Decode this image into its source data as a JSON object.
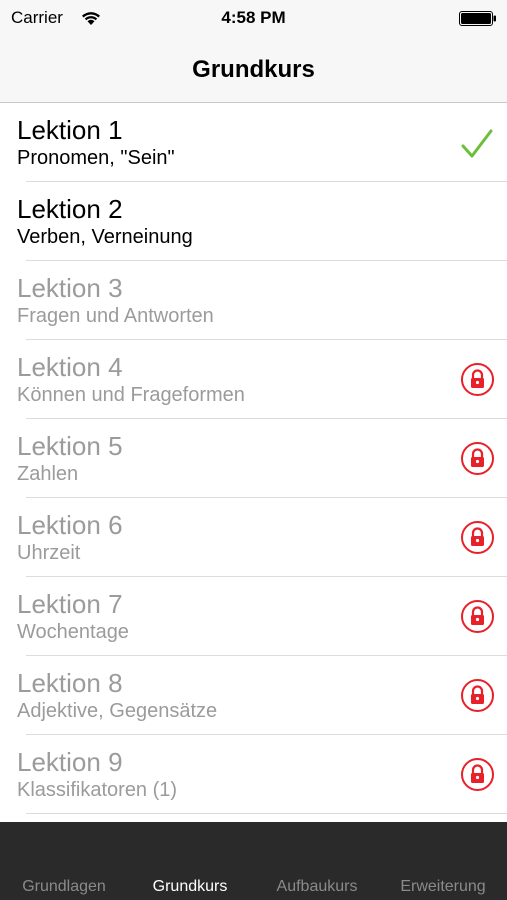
{
  "status_bar": {
    "carrier": "Carrier",
    "time": "4:58 PM",
    "wifi_icon": "wifi-icon",
    "battery_icon": "battery-icon"
  },
  "nav": {
    "title": "Grundkurs"
  },
  "colors": {
    "check": "#6cbf3a",
    "lock": "#e8202a",
    "locked_text": "#9b9b9b",
    "tab_bar": "#2a2a2a"
  },
  "lessons": [
    {
      "title": "Lektion 1",
      "subtitle": "Pronomen, \"Sein\"",
      "state": "completed",
      "icon": "checkmark-icon"
    },
    {
      "title": "Lektion 2",
      "subtitle": "Verben, Verneinung",
      "state": "available",
      "icon": ""
    },
    {
      "title": "Lektion 3",
      "subtitle": "Fragen und Antworten",
      "state": "disabled",
      "icon": ""
    },
    {
      "title": "Lektion 4",
      "subtitle": "Können und Frageformen",
      "state": "locked",
      "icon": "lock-icon"
    },
    {
      "title": "Lektion 5",
      "subtitle": "Zahlen",
      "state": "locked",
      "icon": "lock-icon"
    },
    {
      "title": "Lektion 6",
      "subtitle": "Uhrzeit",
      "state": "locked",
      "icon": "lock-icon"
    },
    {
      "title": "Lektion 7",
      "subtitle": "Wochentage",
      "state": "locked",
      "icon": "lock-icon"
    },
    {
      "title": "Lektion 8",
      "subtitle": "Adjektive, Gegensätze",
      "state": "locked",
      "icon": "lock-icon"
    },
    {
      "title": "Lektion 9",
      "subtitle": "Klassifikatoren (1)",
      "state": "locked",
      "icon": "lock-icon"
    }
  ],
  "tabs": [
    {
      "label": "Grundlagen",
      "active": false
    },
    {
      "label": "Grundkurs",
      "active": true
    },
    {
      "label": "Aufbaukurs",
      "active": false
    },
    {
      "label": "Erweiterung",
      "active": false
    }
  ]
}
